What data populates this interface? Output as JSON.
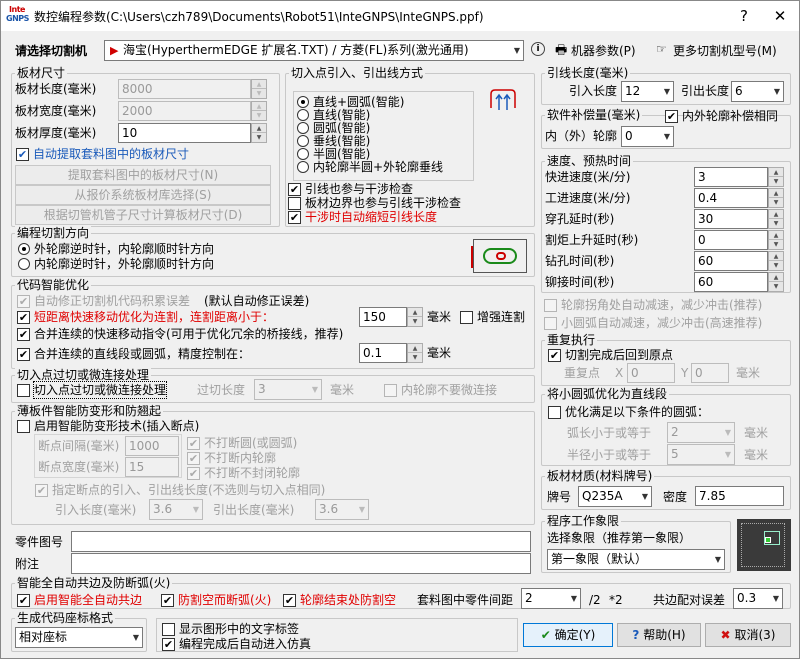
{
  "window": {
    "title": "数控编程参数(C:\\Users\\czh789\\Documents\\Robot51\\InteGNPS\\InteGNPS.ppf)",
    "icon_top": "Inte",
    "icon_bottom": "GNPS",
    "help_glyph": "?",
    "close_glyph": "✕"
  },
  "machine": {
    "label": "请选择切割机",
    "value": "海宝(HyperthermEDGE 扩展名.TXT) / 方菱(FL)系列(激光通用)",
    "params_label": "机器参数(P)",
    "more_label": "更多切割机型号(M)"
  },
  "sheet": {
    "title": "板材尺寸",
    "length_label": "板材长度(毫米)",
    "length": "8000",
    "width_label": "板材宽度(毫米)",
    "width": "2000",
    "thick_label": "板材厚度(毫米)",
    "thick": "10",
    "auto_label": "自动提取套料图中的板材尺寸",
    "btn1": "提取套料图中的板材尺寸(N)",
    "btn2": "从报价系统板材库选择(S)",
    "btn3": "根据切管机管子尺寸计算板材尺寸(D)"
  },
  "lead": {
    "title": "切入点引入、引出线方式",
    "options": [
      "直线+圆弧(智能)",
      "直线(智能)",
      "圆弧(智能)",
      "垂线(智能)",
      "半圆(智能)",
      "内轮廓半圆+外轮廓垂线"
    ],
    "selected": 0,
    "chk1": "引线也参与干涉检查",
    "chk2": "板材边界也参与引线干涉检查",
    "chk3": "干涉时自动缩短引线长度"
  },
  "leadlen": {
    "title": "引线长度(毫米)",
    "in_label": "引入长度",
    "in": "12",
    "out_label": "引出长度",
    "out": "6"
  },
  "comp": {
    "title": "软件补偿量(毫米)",
    "same_label": "内外轮廓补偿相同",
    "io_label": "内（外）轮廓",
    "value": "0"
  },
  "speed": {
    "title": "速度、预热时间",
    "rows": [
      {
        "label": "快进速度(米/分)",
        "value": "3"
      },
      {
        "label": "工进速度(米/分)",
        "value": "0.4"
      },
      {
        "label": "穿孔延时(秒)",
        "value": "30"
      },
      {
        "label": "割炬上升延时(秒)",
        "value": "0"
      },
      {
        "label": "钻孔时间(秒)",
        "value": "60"
      },
      {
        "label": "铆接时间(秒)",
        "value": "60"
      }
    ]
  },
  "corner": {
    "label": "轮廓拐角处自动减速，减少冲击(推荐)"
  },
  "arcslow": {
    "label": "小圆弧自动减速，减少冲击(高速推荐)"
  },
  "repeat": {
    "title": "重复执行",
    "chk": "切割完成后回到原点",
    "origin_label": "重复点",
    "x_label": "X",
    "x": "0",
    "y_label": "Y",
    "y": "0",
    "unit": "毫米"
  },
  "dir": {
    "title": "编程切割方向",
    "opt1": "外轮廓逆时针，内轮廓顺时针方向",
    "opt2": "内轮廓逆时针，外轮廓顺时针方向"
  },
  "opt": {
    "title": "代码智能优化",
    "auto_fix": "自动修正切割机代码积累误差",
    "auto_fix_note": "(默认自动修正误差)",
    "short_link": "短距离快速移动优化为连割，连割距离小于：",
    "short_value": "150",
    "unit": "毫米",
    "bridge": "增强连割",
    "merge_rapid": "合并连续的快速移动指令(可用于优化冗余的桥接线，推荐)",
    "merge_line": "合并连续的直线段或圆弧，精度控制在：",
    "merge_value": "0.1"
  },
  "overcut": {
    "title": "切入点过切或微连接处理",
    "chk": "切入点过切或微连接处理",
    "len_label": "过切长度",
    "len": "3",
    "unit": "毫米",
    "inner": "内轮廓不要微连接"
  },
  "thin": {
    "title": "薄板件智能防变形和防翘起",
    "enable": "启用智能防变形技术(插入断点)",
    "gap_label": "断点间隔(毫米)",
    "gap": "1000",
    "width_label": "断点宽度(毫米)",
    "width": "15",
    "no_circle": "不打断圆(或圆弧)",
    "no_inner": "不打断内轮廓",
    "no_open": "不打断不封闭轮廓",
    "specify": "指定断点的引入、引出线长度(不选则与切入点相同)",
    "in_label": "引入长度(毫米)",
    "in": "3.6",
    "out_label": "引出长度(毫米)",
    "out": "3.6"
  },
  "toarc": {
    "title": "将小圆弧优化为直线段",
    "chk": "优化满足以下条件的圆弧：",
    "len_label": "弧长小于或等于",
    "len": "2",
    "radius_label": "半径小于或等于",
    "radius": "5",
    "unit": "毫米"
  },
  "material": {
    "title": "板材材质(材料牌号)",
    "grade_label": "牌号",
    "grade": "Q235A",
    "density_label": "密度",
    "density": "7.85"
  },
  "quadrant": {
    "title": "程序工作象限",
    "label": "选择象限（推荐第一象限）",
    "value": "第一象限（默认）"
  },
  "part": {
    "drawing_label": "零件图号",
    "note_label": "附注"
  },
  "common": {
    "title": "智能全自动共边及防断弧(火)",
    "auto": "启用智能全自动共边",
    "prevent": "防割空而断弧(火)",
    "end": "轮廓结束处防割空",
    "spacing_label": "套料图中零件间距",
    "spacing": "2",
    "div": "/2",
    "mul": "*2",
    "tol_label": "共边配对误差",
    "tol": "0.3"
  },
  "coord": {
    "title": "生成代码座标格式",
    "value": "相对座标"
  },
  "bottom": {
    "show_text": "显示图形中的文字标签",
    "sim": "编程完成后自动进入仿真",
    "ok": "确定(Y)",
    "help": "帮助(H)",
    "cancel": "取消(3)"
  },
  "colors": {
    "red": "#e00000",
    "ok_green": "#1a8a1a",
    "cancel_red": "#d01010",
    "help_blue": "#1a5aba"
  }
}
